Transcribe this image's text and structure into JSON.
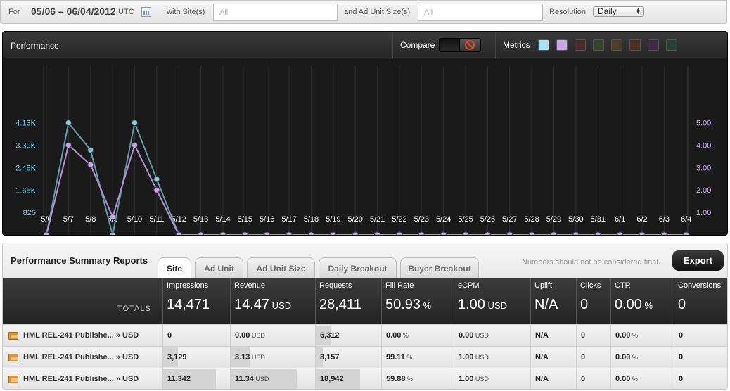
{
  "filter": {
    "for_label": "For",
    "date_range": "05/06 – 06/04/2012",
    "timezone": "UTC",
    "calendar_icon": "calendar-icon",
    "sites_label": "with Site(s)",
    "sites_placeholder": "All",
    "adunit_label": "and Ad Unit Size(s)",
    "adunit_placeholder": "All",
    "resolution_label": "Resolution",
    "resolution_value": "Daily"
  },
  "performance": {
    "title": "Performance",
    "compare_label": "Compare",
    "compare_state": "off",
    "metrics_label": "Metrics",
    "metric_swatches": [
      "#a9e2f5",
      "#c9a6ea",
      "#4a2a2a",
      "#36432a",
      "#4a3f26",
      "#4d2e22",
      "#3e2a45",
      "#283f32"
    ],
    "colors": {
      "series1": "#6fd1ec",
      "series2": "#c9a6ea",
      "line1": "#5f9ea6",
      "line2": "#b78fd8"
    }
  },
  "chart_data": {
    "type": "line",
    "categories": [
      "5/6",
      "5/7",
      "5/8",
      "5/9",
      "5/10",
      "5/11",
      "5/12",
      "5/13",
      "5/14",
      "5/15",
      "5/16",
      "5/17",
      "5/18",
      "5/19",
      "5/20",
      "5/21",
      "5/22",
      "5/23",
      "5/24",
      "5/25",
      "5/26",
      "5/27",
      "5/28",
      "5/29",
      "5/30",
      "5/31",
      "6/1",
      "6/2",
      "6/3",
      "6/4"
    ],
    "y_left_ticks": [
      "825",
      "1.65K",
      "2.48K",
      "3.30K",
      "4.13K"
    ],
    "y_left_max": 4950,
    "y_right_ticks": [
      "1.00",
      "2.00",
      "3.00",
      "4.00",
      "5.00"
    ],
    "y_right_max": 5.99,
    "series": [
      {
        "axis": "left",
        "values": [
          0,
          4130,
          3129,
          1,
          4130,
          2050,
          0,
          0,
          0,
          0,
          0,
          0,
          0,
          0,
          0,
          0,
          0,
          0,
          0,
          0,
          0,
          0,
          0,
          0,
          0,
          0,
          0,
          0,
          0,
          0
        ]
      },
      {
        "axis": "right",
        "values": [
          0,
          4.0,
          3.13,
          0.8,
          4.0,
          2.0,
          0,
          0,
          0,
          0,
          0,
          0,
          0,
          0,
          0,
          0,
          0,
          0,
          0,
          0,
          0,
          0,
          0,
          0,
          0,
          0,
          0,
          0,
          0,
          0
        ]
      }
    ],
    "grid": "vertical"
  },
  "summary": {
    "title": "Performance Summary Reports",
    "tabs": [
      "Site",
      "Ad Unit",
      "Ad Unit Size",
      "Daily Breakout",
      "Buyer Breakout"
    ],
    "active_tab": "Site",
    "note": "Numbers should not be considered final.",
    "export_label": "Export",
    "totals_label": "TOTALS",
    "columns": [
      "Impressions",
      "Revenue",
      "Requests",
      "Fill Rate",
      "eCPM",
      "Uplift",
      "Clicks",
      "CTR",
      "Conversions"
    ],
    "totals": [
      {
        "value": "14,471",
        "unit": ""
      },
      {
        "value": "14.47",
        "unit": "USD"
      },
      {
        "value": "28,411",
        "unit": ""
      },
      {
        "value": "50.93",
        "unit": "%"
      },
      {
        "value": "1.00",
        "unit": "USD"
      },
      {
        "value": "N/A",
        "unit": ""
      },
      {
        "value": "0",
        "unit": ""
      },
      {
        "value": "0.00",
        "unit": "%"
      },
      {
        "value": "0",
        "unit": ""
      }
    ],
    "rows": [
      {
        "name": "HML REL-241 Publishe... » USD",
        "cells": [
          {
            "value": "0",
            "unit": "",
            "share": 0
          },
          {
            "value": "0.00",
            "unit": "USD",
            "share": 0
          },
          {
            "value": "6,312",
            "unit": "",
            "share": 0.22
          },
          {
            "value": "0.00",
            "unit": "%",
            "share": 0
          },
          {
            "value": "0.00",
            "unit": "USD",
            "share": 0
          },
          {
            "value": "N/A",
            "unit": "",
            "share": 0
          },
          {
            "value": "0",
            "unit": "",
            "share": 0
          },
          {
            "value": "0.00",
            "unit": "%",
            "share": 0
          },
          {
            "value": "0",
            "unit": "",
            "share": 0
          }
        ]
      },
      {
        "name": "HML REL-241 Publishe... » USD",
        "cells": [
          {
            "value": "3,129",
            "unit": "",
            "share": 0.22
          },
          {
            "value": "3.13",
            "unit": "USD",
            "share": 0.22
          },
          {
            "value": "3,157",
            "unit": "",
            "share": 0.11
          },
          {
            "value": "99.11",
            "unit": "%",
            "share": 0
          },
          {
            "value": "1.00",
            "unit": "USD",
            "share": 0
          },
          {
            "value": "N/A",
            "unit": "",
            "share": 0
          },
          {
            "value": "0",
            "unit": "",
            "share": 0
          },
          {
            "value": "0.00",
            "unit": "%",
            "share": 0
          },
          {
            "value": "0",
            "unit": "",
            "share": 0
          }
        ]
      },
      {
        "name": "HML REL-241 Publishe... » USD",
        "cells": [
          {
            "value": "11,342",
            "unit": "",
            "share": 0.78
          },
          {
            "value": "11.34",
            "unit": "USD",
            "share": 0.78
          },
          {
            "value": "18,942",
            "unit": "",
            "share": 0.67
          },
          {
            "value": "59.88",
            "unit": "%",
            "share": 0
          },
          {
            "value": "1.00",
            "unit": "USD",
            "share": 0
          },
          {
            "value": "N/A",
            "unit": "",
            "share": 0
          },
          {
            "value": "0",
            "unit": "",
            "share": 0
          },
          {
            "value": "0.00",
            "unit": "%",
            "share": 0
          },
          {
            "value": "0",
            "unit": "",
            "share": 0
          }
        ]
      }
    ]
  }
}
